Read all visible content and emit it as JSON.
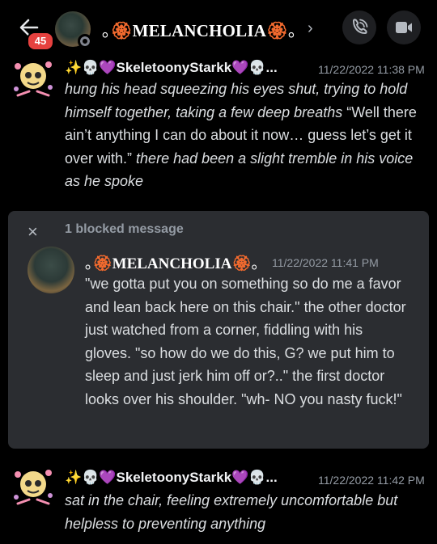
{
  "header": {
    "back_icon": "arrow-left-icon",
    "badge_count": "45",
    "title_prefix": "｡",
    "flower": "🏵",
    "title": "MELANCHOLIA",
    "title_suffix": "｡",
    "chevron": "›",
    "call_icon": "phone-icon",
    "video_icon": "video-camera-icon"
  },
  "messages": [
    {
      "username": "✨💀💜SkeletoonyStarkk💜💀...",
      "timestamp": "11/22/2022 11:38 PM",
      "body_italic_1": "hung his head squeezing his eyes shut, trying to hold himself together, taking a few deep breaths",
      "body_plain": "“Well there ain’t anything I can do about it now… guess let’s get it over with.”",
      "body_italic_2": "there had been a slight tremble in his voice as he spoke"
    },
    {
      "username": "✨💀💜SkeletoonyStarkk💜💀...",
      "timestamp": "11/22/2022 11:42 PM",
      "body_italic_1": "sat in the chair, feeling extremely uncomfortable but helpless to preventing anything"
    }
  ],
  "blocked": {
    "close_icon": "×",
    "label": "1 blocked message",
    "name_prefix": "｡",
    "flower": "🏵",
    "name": "MELANCHOLIA",
    "name_suffix": "｡",
    "timestamp": "11/22/2022 11:41 PM",
    "text": "\"we gotta put you on something so do me a favor and lean back here on this chair.\" the other doctor just watched from a corner, fiddling with his gloves. \"so how do we do this, G? we put him to sleep and just jerk him off or?..\" the first doctor looks over his shoulder. \"wh- NO you nasty fuck!\""
  },
  "colors": {
    "background": "#000000",
    "card": "#2b2d31",
    "badge": "#e6413f",
    "timestamp": "#949ba4",
    "text": "#dbdee1"
  }
}
